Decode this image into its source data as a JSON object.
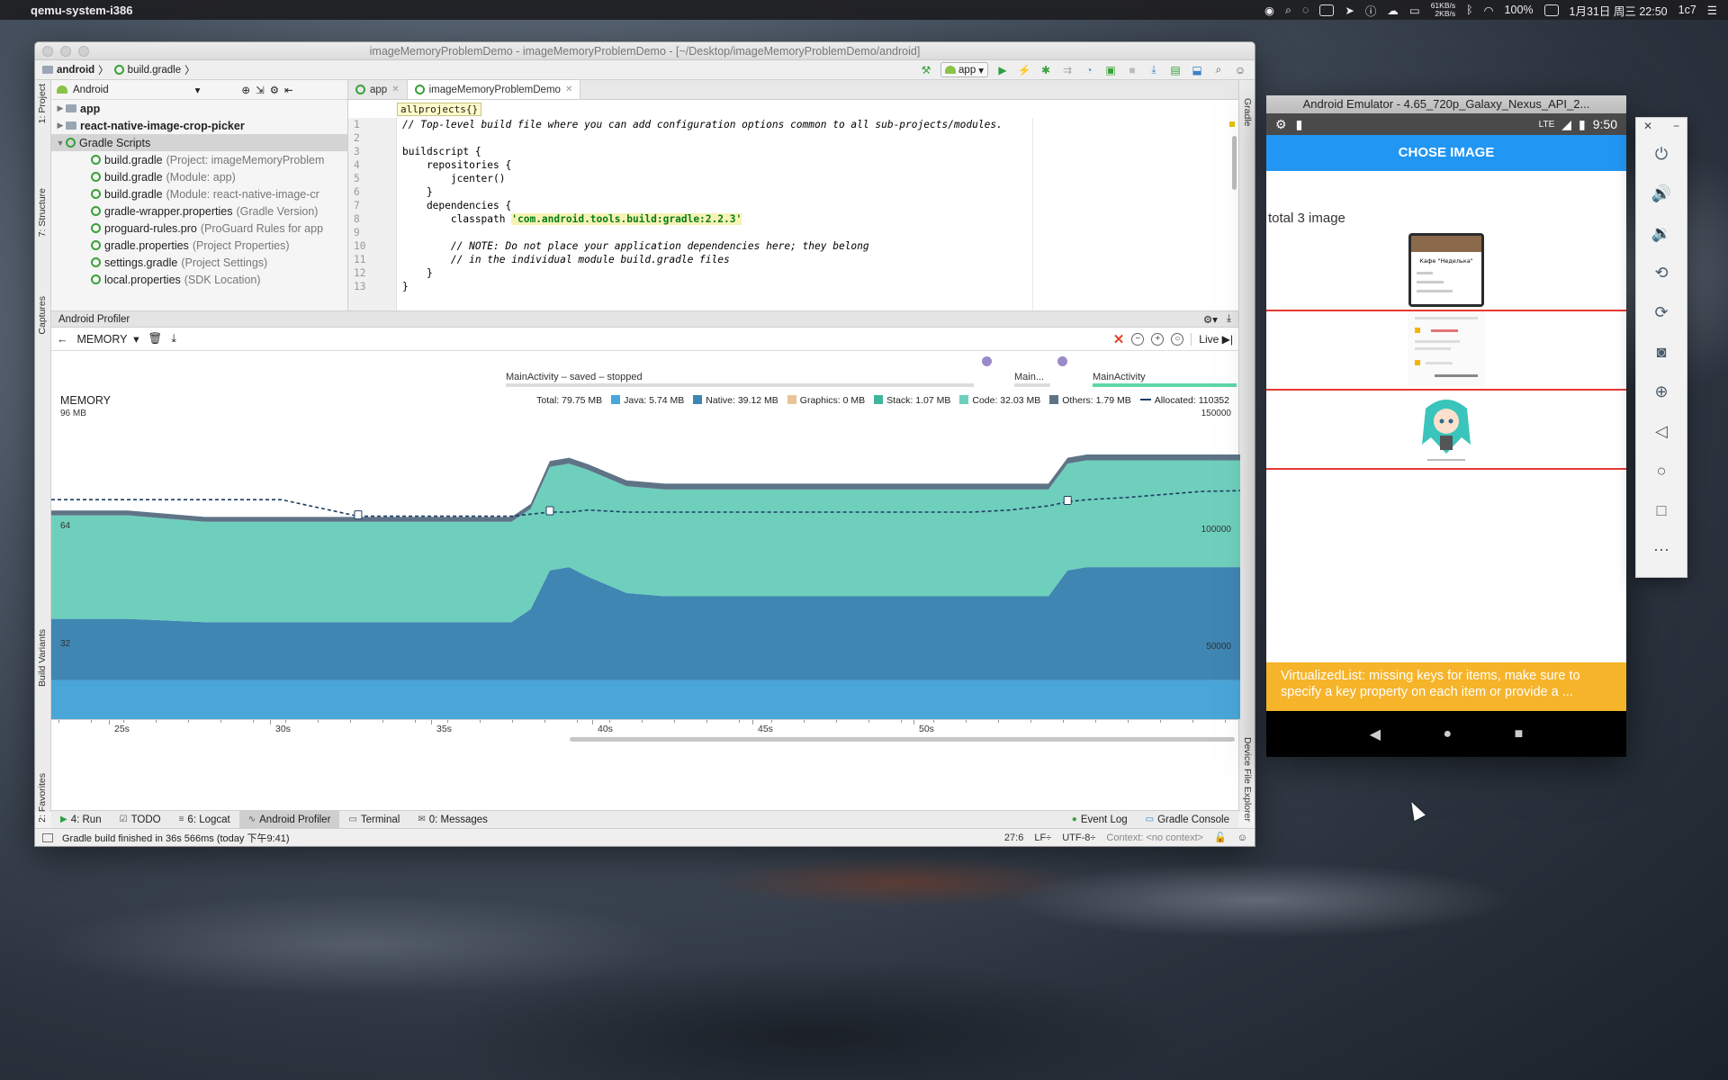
{
  "menubar": {
    "app_name": "qemu-system-i386",
    "net_up": "61KB/s",
    "net_down": "2KB/s",
    "battery": "100%",
    "datetime": "1月31日 周三  22:50",
    "user": "1c7"
  },
  "ide": {
    "window_title": "imageMemoryProblemDemo - imageMemoryProblemDemo - [~/Desktop/imageMemoryProblemDemo/android]",
    "breadcrumb": [
      "android",
      "build.gradle"
    ],
    "run_config": "app",
    "project_view": "Android",
    "tree": [
      {
        "label": "app",
        "hint": "",
        "bold": true,
        "level": 0,
        "arrow": "▶"
      },
      {
        "label": "react-native-image-crop-picker",
        "hint": "",
        "bold": true,
        "level": 0,
        "arrow": "▶"
      },
      {
        "label": "Gradle Scripts",
        "hint": "",
        "bold": false,
        "level": 0,
        "arrow": "▼"
      },
      {
        "label": "build.gradle",
        "hint": "(Project: imageMemoryProblem",
        "level": 1
      },
      {
        "label": "build.gradle",
        "hint": "(Module: app)",
        "level": 1
      },
      {
        "label": "build.gradle",
        "hint": "(Module: react-native-image-cr",
        "level": 1
      },
      {
        "label": "gradle-wrapper.properties",
        "hint": "(Gradle Version)",
        "level": 1
      },
      {
        "label": "proguard-rules.pro",
        "hint": "(ProGuard Rules for app",
        "level": 1
      },
      {
        "label": "gradle.properties",
        "hint": "(Project Properties)",
        "level": 1
      },
      {
        "label": "settings.gradle",
        "hint": "(Project Settings)",
        "level": 1
      },
      {
        "label": "local.properties",
        "hint": "(SDK Location)",
        "level": 1
      }
    ],
    "tabs": [
      {
        "label": "app",
        "active": false
      },
      {
        "label": "imageMemoryProblemDemo",
        "active": true
      }
    ],
    "code_crumb": "allprojects{}",
    "code_lines": [
      "// Top-level build file where you can add configuration options common to all sub-projects/modules.",
      "",
      "buildscript {",
      "    repositories {",
      "        jcenter()",
      "    }",
      "    dependencies {",
      "        classpath 'com.android.tools.build:gradle:2.2.3'",
      "",
      "        // NOTE: Do not place your application dependencies here; they belong",
      "        // in the individual module build.gradle files",
      "    }",
      "}"
    ],
    "left_tabs": [
      "1: Project",
      "7: Structure",
      "Captures",
      "Build Variants",
      "2: Favorites"
    ],
    "right_tabs": [
      "Gradle",
      "Device File Explorer"
    ],
    "profiler": {
      "panel_title": "Android Profiler",
      "selector": "MEMORY",
      "live_label": "Live",
      "activities": [
        "MainActivity – saved – stopped",
        "Main...",
        "MainActivity"
      ],
      "memory_title": "MEMORY",
      "legend": [
        {
          "label": "Total: 79.75 MB",
          "color": ""
        },
        {
          "label": "Java: 5.74 MB",
          "color": "#4aa6d8"
        },
        {
          "label": "Native: 39.12 MB",
          "color": "#3f86b3"
        },
        {
          "label": "Graphics: 0 MB",
          "color": "#e8c498"
        },
        {
          "label": "Stack: 1.07 MB",
          "color": "#3fb69c"
        },
        {
          "label": "Code: 32.03 MB",
          "color": "#6fcfbd"
        },
        {
          "label": "Others: 1.79 MB",
          "color": "#5e7486"
        },
        {
          "label": "Allocated: 110352",
          "color": "#1c3e64"
        }
      ],
      "y_left": [
        "96 MB",
        "64",
        "32"
      ],
      "y_right": [
        "150000",
        "100000",
        "50000"
      ],
      "x_ticks": [
        "25s",
        "30s",
        "35s",
        "40s",
        "45s",
        "50s"
      ]
    },
    "toolwindows": [
      {
        "label": "4: Run",
        "icon": "▶",
        "active": false
      },
      {
        "label": "TODO",
        "icon": "☑",
        "active": false
      },
      {
        "label": "6: Logcat",
        "icon": "≡",
        "active": false
      },
      {
        "label": "Android Profiler",
        "icon": "∿",
        "active": true
      },
      {
        "label": "Terminal",
        "icon": "▭",
        "active": false
      },
      {
        "label": "0: Messages",
        "icon": "✉",
        "active": false
      }
    ],
    "toolwindows_right": [
      "Event Log",
      "Gradle Console"
    ],
    "status": {
      "message": "Gradle build finished in 36s 566ms (today 下午9:41)",
      "position": "27:6",
      "line_sep": "LF÷",
      "encoding": "UTF-8÷",
      "context": "Context: <no context>"
    }
  },
  "emulator": {
    "title": "Android Emulator - 4.65_720p_Galaxy_Nexus_API_2...",
    "time": "9:50",
    "network": "LTE",
    "app_bar": "CHOSE IMAGE",
    "total_text": "total 3 image",
    "thumb1_title": "Кафе \"Неделька\"",
    "warning": "VirtualizedList: missing keys for items, make sure to specify a key property on each item or provide a ..."
  },
  "chart_data": {
    "type": "area",
    "title": "MEMORY",
    "x": [
      22,
      24,
      26,
      28,
      30,
      32,
      33,
      34,
      34.5,
      35,
      35.5,
      36,
      37,
      38,
      40,
      42,
      44,
      46,
      47,
      48,
      48.5,
      49,
      50,
      52,
      53
    ],
    "ylim_mb": [
      0,
      96
    ],
    "series": [
      {
        "name": "Java",
        "values": [
          12,
          12,
          12,
          12,
          12,
          12,
          12,
          12,
          12,
          12,
          12,
          12,
          12,
          12,
          12,
          12,
          12,
          12,
          12,
          12,
          12,
          12,
          12,
          12,
          12
        ]
      },
      {
        "name": "Native",
        "values": [
          19,
          19,
          18,
          18,
          18,
          18,
          18,
          18,
          22,
          34,
          35,
          32,
          27,
          26,
          26,
          26,
          26,
          26,
          26,
          26,
          34,
          35,
          35,
          35,
          35
        ]
      },
      {
        "name": "Code",
        "values": [
          32,
          32,
          31,
          31,
          31,
          31,
          31,
          31,
          31,
          32,
          32,
          33,
          33,
          33,
          33,
          33,
          33,
          33,
          33,
          33,
          33,
          33,
          33,
          33,
          33
        ]
      },
      {
        "name": "Others",
        "values": [
          1.5,
          1.5,
          1.5,
          1.5,
          1.5,
          1.5,
          1.5,
          1.5,
          1.5,
          1.8,
          1.8,
          1.8,
          1.8,
          1.8,
          1.8,
          1.8,
          1.8,
          1.8,
          1.8,
          1.8,
          1.8,
          1.8,
          1.8,
          1.8,
          1.8
        ]
      },
      {
        "name": "Allocated",
        "values": [
          106000,
          106000,
          106000,
          106000,
          98000,
          98000,
          98000,
          98000,
          99000,
          100000,
          100000,
          101000,
          100000,
          100000,
          100000,
          100000,
          100000,
          100000,
          101000,
          103000,
          105000,
          106000,
          107000,
          110000,
          110352
        ]
      }
    ]
  }
}
